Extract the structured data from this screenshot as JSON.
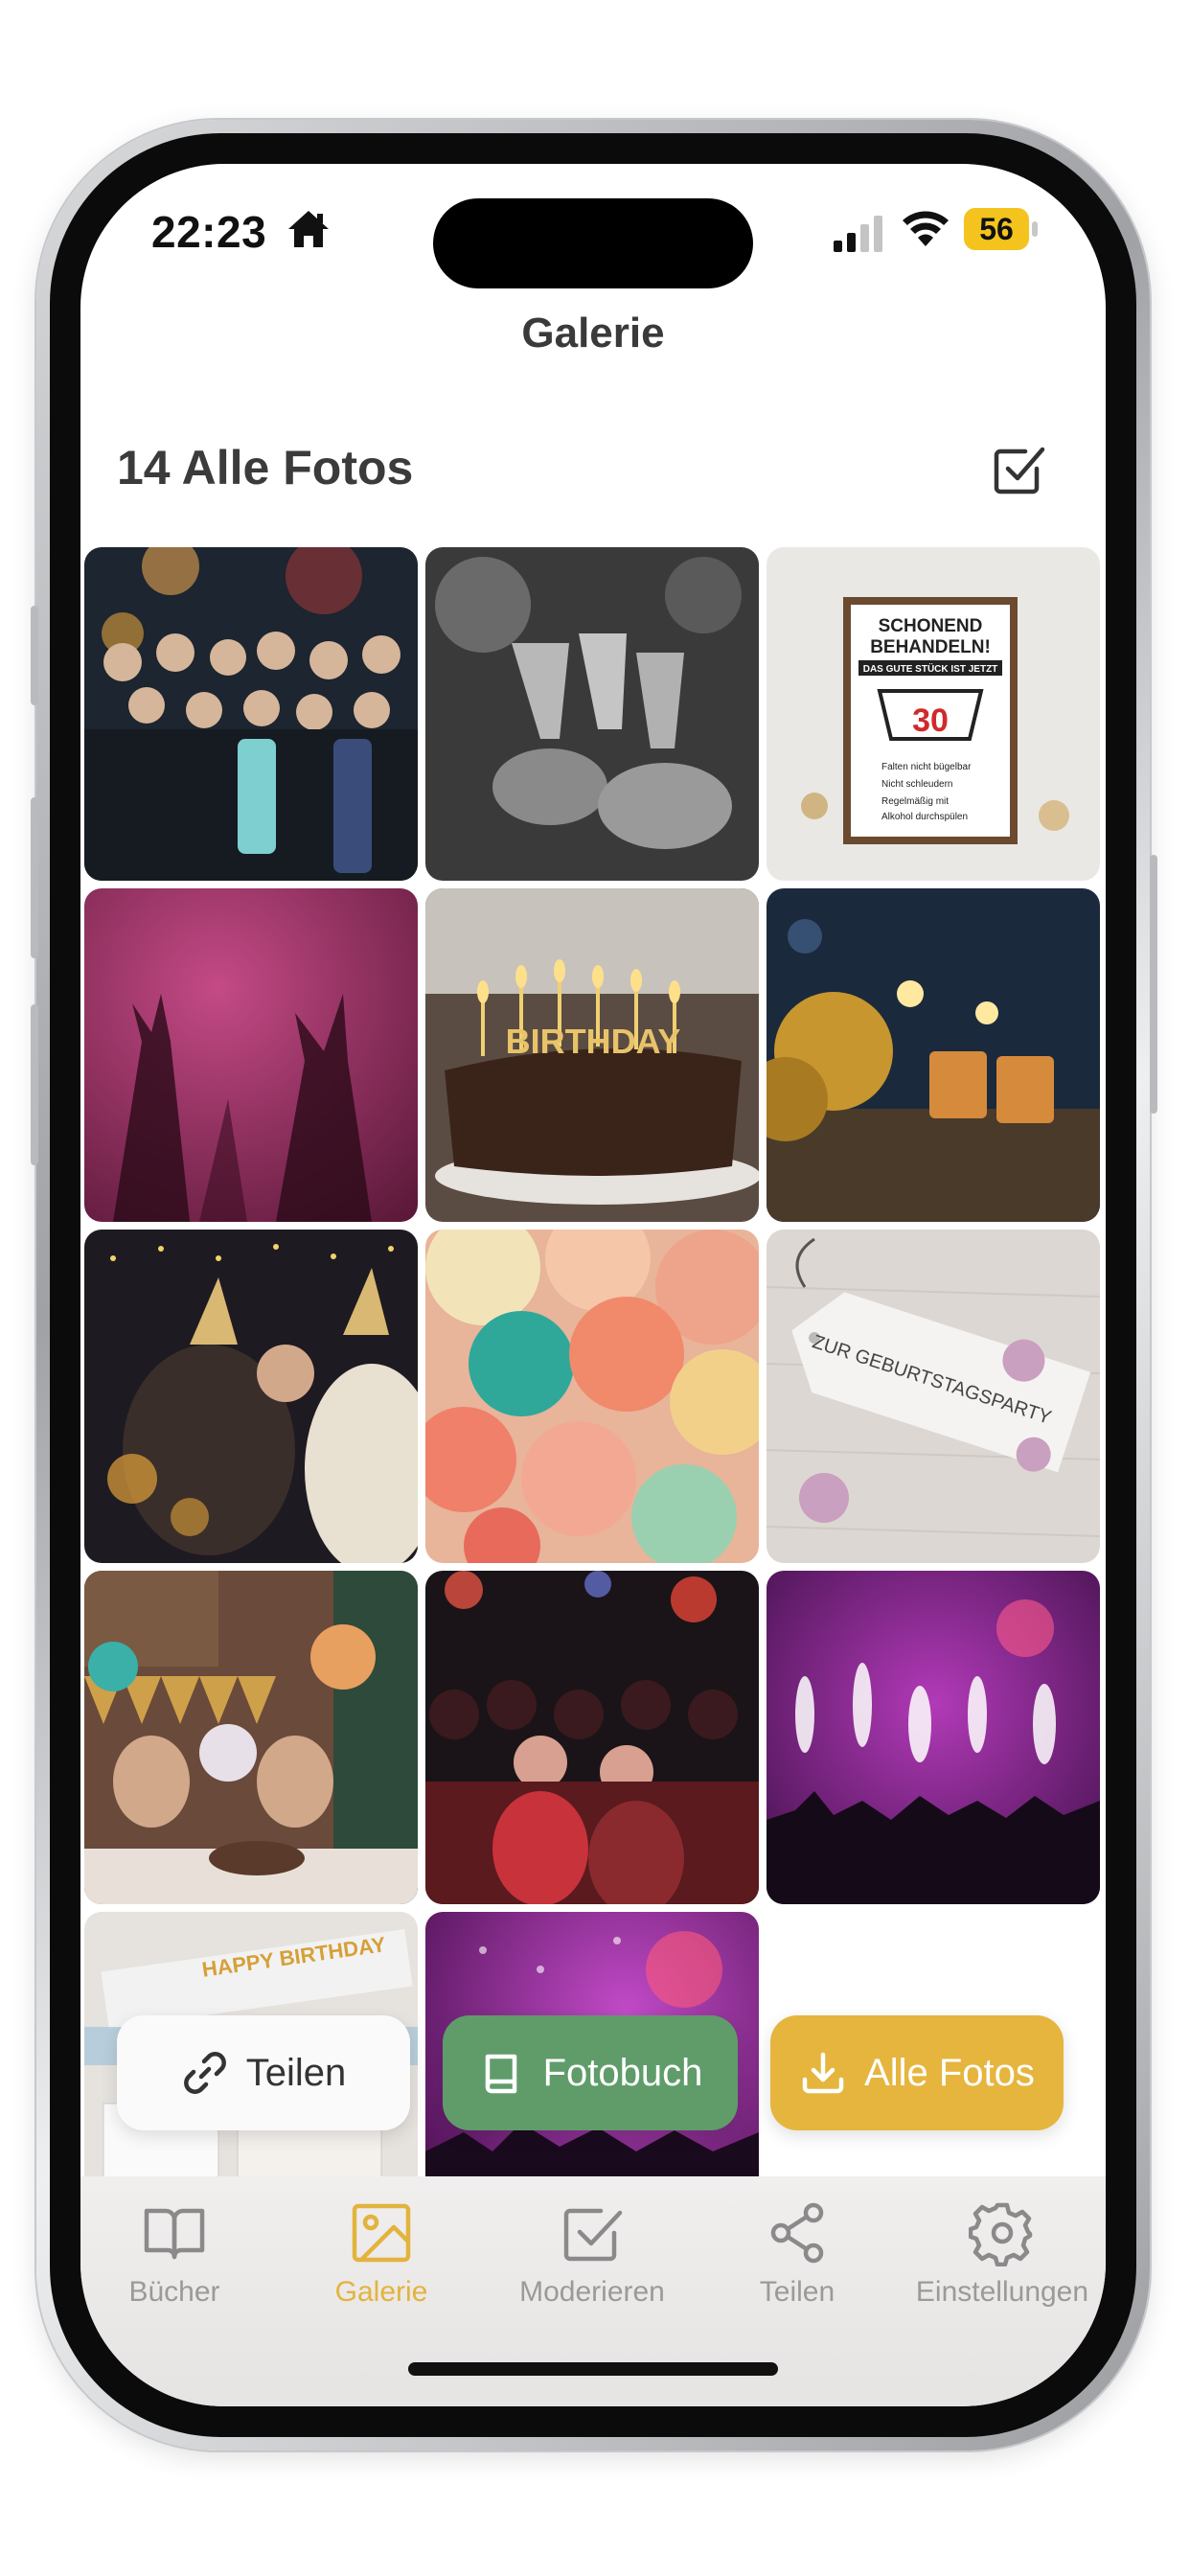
{
  "status_bar": {
    "time": "22:23",
    "battery": "56"
  },
  "header": {
    "title": "Galerie"
  },
  "gallery": {
    "title": "14 Alle Fotos",
    "photos": [
      {
        "name": "group-party-photo",
        "sign": ""
      },
      {
        "name": "toast-bw-photo",
        "sign": ""
      },
      {
        "name": "sign-30-photo",
        "sign_lines": [
          "SCHONEND",
          "BEHANDELN!",
          "DAS GUTE STÜCK IST JETZT"
        ],
        "sign_number": "30",
        "sign_items": [
          "Falten nicht bügelbar",
          "Nicht schleudern",
          "Regelmäßig mit",
          "Alkohol durchspülen"
        ]
      },
      {
        "name": "pink-hands-photo"
      },
      {
        "name": "birthday-cake-photo",
        "caption": "BIRTHDAY"
      },
      {
        "name": "gold-balloons-photo"
      },
      {
        "name": "party-hats-photo"
      },
      {
        "name": "balloons-photo"
      },
      {
        "name": "tag-photo",
        "caption": "ZUR GEBURTSTAGSPARTY"
      },
      {
        "name": "birthday-table-photo"
      },
      {
        "name": "crowd-photo"
      },
      {
        "name": "fireworks-photo"
      },
      {
        "name": "banner-photo",
        "caption": "HAPPY BIRTHDAY"
      },
      {
        "name": "concert-photo"
      }
    ]
  },
  "actions": {
    "share": "Teilen",
    "photobook": "Fotobuch",
    "all_photos": "Alle Fotos"
  },
  "tabs": [
    {
      "label": "Bücher",
      "icon": "book-icon",
      "active": false
    },
    {
      "label": "Galerie",
      "icon": "image-icon",
      "active": true
    },
    {
      "label": "Moderieren",
      "icon": "checkbox-icon",
      "active": false
    },
    {
      "label": "Teilen",
      "icon": "share-icon",
      "active": false
    },
    {
      "label": "Einstellungen",
      "icon": "gear-icon",
      "active": false
    }
  ],
  "colors": {
    "accent": "#e2b43d",
    "photobook_green": "#5f9c6a",
    "battery_yellow": "#f4c31e"
  }
}
